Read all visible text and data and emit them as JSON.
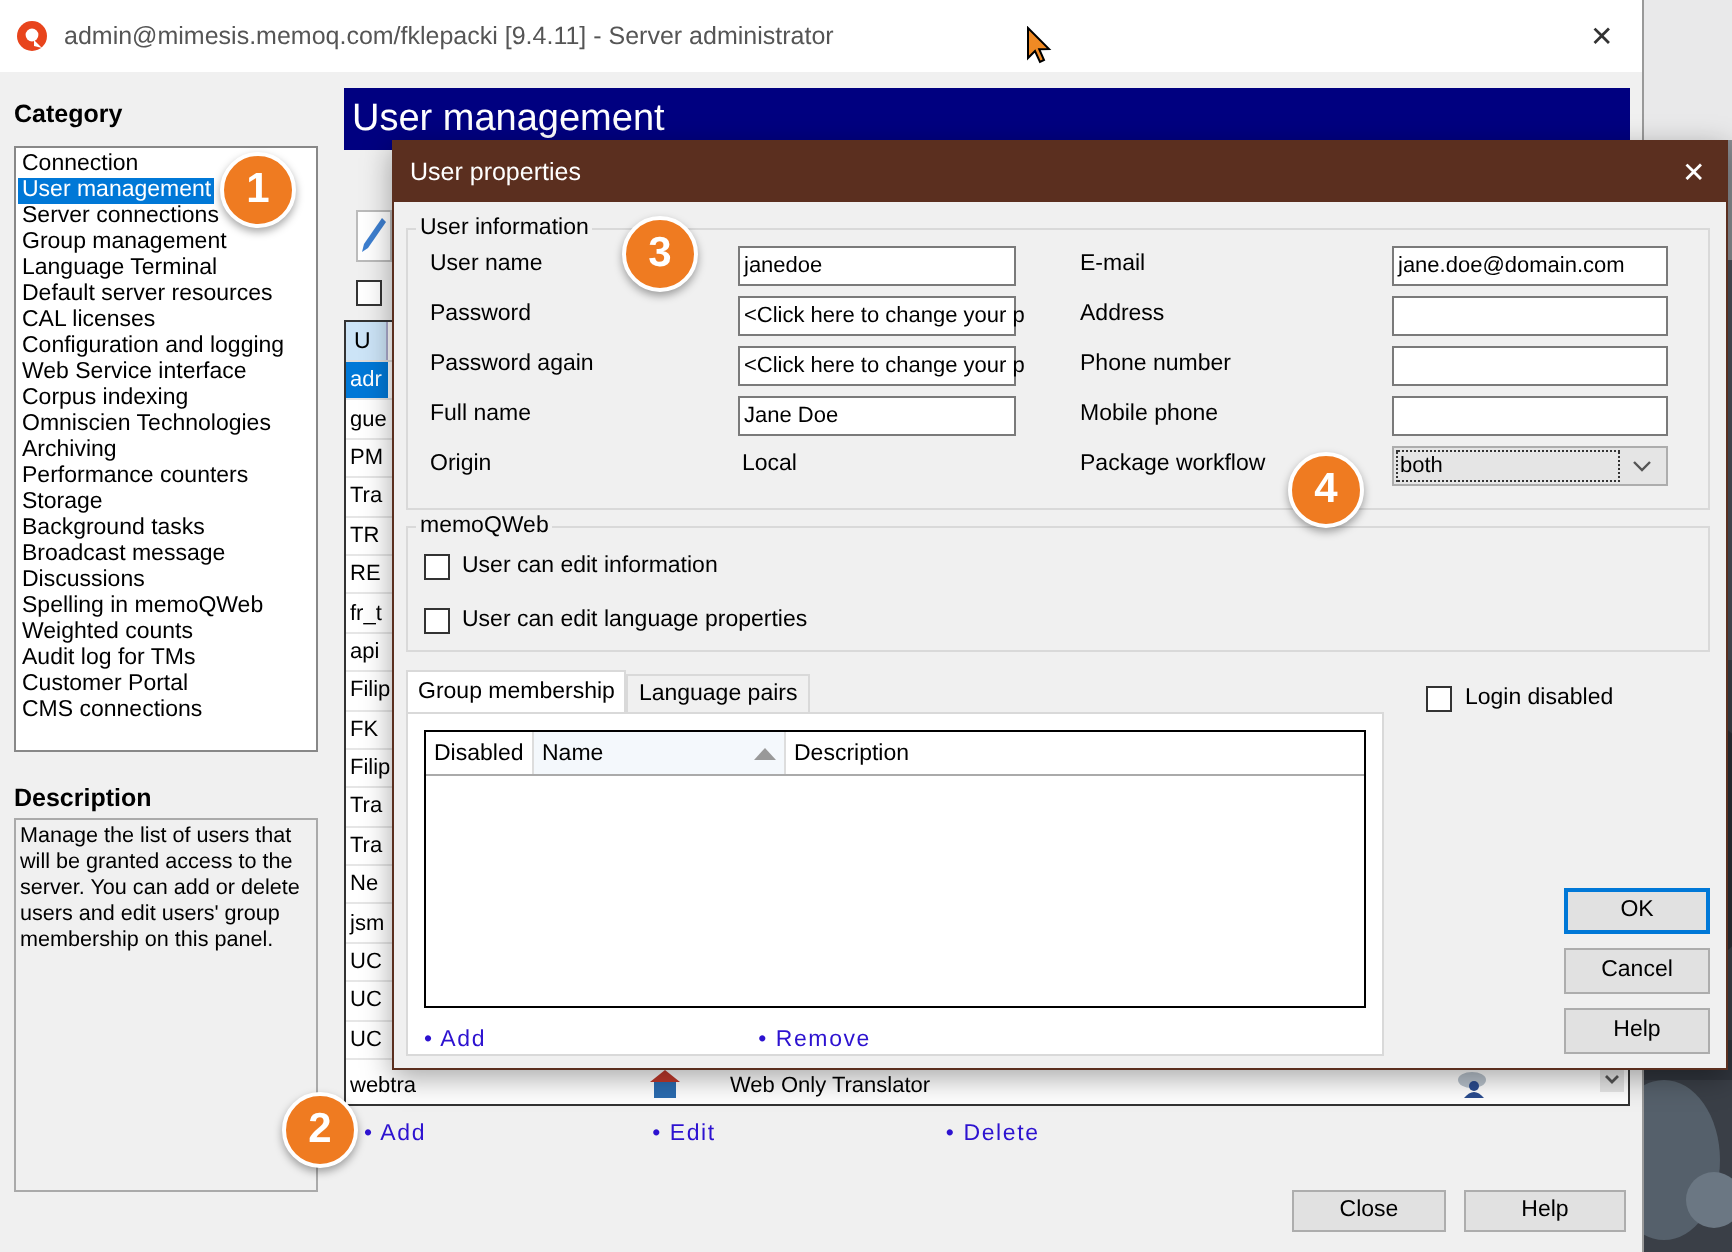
{
  "window": {
    "title": "admin@mimesis.memoq.com/fklepacki [9.4.11] - Server administrator",
    "close": "✕"
  },
  "category": {
    "heading": "Category",
    "items": [
      {
        "label": "Connection",
        "selected": false
      },
      {
        "label": "User management",
        "selected": true
      },
      {
        "label": "Server connections",
        "selected": false
      },
      {
        "label": "Group management",
        "selected": false
      },
      {
        "label": "Language Terminal",
        "selected": false
      },
      {
        "label": "Default server resources",
        "selected": false
      },
      {
        "label": "CAL licenses",
        "selected": false
      },
      {
        "label": "Configuration and logging",
        "selected": false
      },
      {
        "label": "Web Service interface",
        "selected": false
      },
      {
        "label": "Corpus indexing",
        "selected": false
      },
      {
        "label": "Omniscien Technologies",
        "selected": false
      },
      {
        "label": "Archiving",
        "selected": false
      },
      {
        "label": "Performance counters",
        "selected": false
      },
      {
        "label": "Storage",
        "selected": false
      },
      {
        "label": "Background tasks",
        "selected": false
      },
      {
        "label": "Broadcast message",
        "selected": false
      },
      {
        "label": "Discussions",
        "selected": false
      },
      {
        "label": "Spelling in memoQWeb",
        "selected": false
      },
      {
        "label": "Weighted counts",
        "selected": false
      },
      {
        "label": "Audit log for TMs",
        "selected": false
      },
      {
        "label": "Customer Portal",
        "selected": false
      },
      {
        "label": "CMS connections",
        "selected": false
      }
    ]
  },
  "description": {
    "heading": "Description",
    "text": "Manage the list of users that will be granted access to the server. You can add or delete users and edit users' group membership on this panel."
  },
  "panel": {
    "header": "User management",
    "filter_checkbox": {
      "checked": false
    },
    "users_table": {
      "header": "U",
      "rows": [
        {
          "cells": [
            "adr"
          ],
          "selected": true
        },
        {
          "cells": [
            "gue"
          ],
          "selected": false
        },
        {
          "cells": [
            "PM"
          ],
          "selected": false
        },
        {
          "cells": [
            "Tra"
          ],
          "selected": false
        },
        {
          "cells": [
            "TR"
          ],
          "selected": false
        },
        {
          "cells": [
            "RE"
          ],
          "selected": false
        },
        {
          "cells": [
            "fr_t"
          ],
          "selected": false
        },
        {
          "cells": [
            "api"
          ],
          "selected": false
        },
        {
          "cells": [
            "Filip"
          ],
          "selected": false
        },
        {
          "cells": [
            "FK"
          ],
          "selected": false
        },
        {
          "cells": [
            "Filip"
          ],
          "selected": false
        },
        {
          "cells": [
            "Tra"
          ],
          "selected": false
        },
        {
          "cells": [
            "Tra"
          ],
          "selected": false
        },
        {
          "cells": [
            "Ne"
          ],
          "selected": false
        },
        {
          "cells": [
            "jsm"
          ],
          "selected": false
        },
        {
          "cells": [
            "UC"
          ],
          "selected": false
        },
        {
          "cells": [
            "UC"
          ],
          "selected": false
        },
        {
          "cells": [
            "UC"
          ],
          "selected": false
        },
        {
          "cells": [
            "webtra",
            "Web Only Translator"
          ],
          "selected": false
        }
      ]
    },
    "links": [
      "• Add",
      "• Edit",
      "• Delete"
    ],
    "buttons": [
      "Close",
      "Help"
    ]
  },
  "dialog": {
    "title": "User properties",
    "close": "✕",
    "user_information": {
      "legend": "User information",
      "left_fields": [
        {
          "label": "User name",
          "kind": "input",
          "value": "janedoe"
        },
        {
          "label": "Password",
          "kind": "input",
          "value": "<Click here to change your p"
        },
        {
          "label": "Password again",
          "kind": "input",
          "value": "<Click here to change your p"
        },
        {
          "label": "Full name",
          "kind": "input",
          "value": "Jane Doe"
        },
        {
          "label": "Origin",
          "kind": "text",
          "value": "Local"
        }
      ],
      "right_fields": [
        {
          "label": "E-mail",
          "kind": "input",
          "value": "jane.doe@domain.com"
        },
        {
          "label": "Address",
          "kind": "input"
        },
        {
          "label": "Phone number",
          "kind": "input"
        },
        {
          "label": "Mobile phone",
          "kind": "input"
        },
        {
          "label": "Package workflow",
          "kind": "select",
          "value": "both"
        }
      ]
    },
    "memoqweb": {
      "legend": "memoQWeb",
      "options": [
        {
          "label": "User can edit information",
          "checked": false
        },
        {
          "label": "User can edit language properties",
          "checked": false
        }
      ]
    },
    "tabs": [
      {
        "label": "Group membership",
        "selected": true
      },
      {
        "label": "Language pairs",
        "selected": false
      }
    ],
    "group_table": {
      "columns": [
        {
          "label": "Disabled",
          "sorted": false
        },
        {
          "label": "Name",
          "sorted": true
        },
        {
          "label": "Description",
          "sorted": false
        }
      ]
    },
    "tab_links": [
      "• Add",
      "• Remove"
    ],
    "login_disabled": {
      "label": "Login disabled",
      "checked": false
    },
    "buttons": [
      {
        "label": "OK",
        "default": true
      },
      {
        "label": "Cancel",
        "default": false
      },
      {
        "label": "Help",
        "default": false
      }
    ]
  },
  "markers": [
    "1",
    "2",
    "3",
    "4"
  ]
}
